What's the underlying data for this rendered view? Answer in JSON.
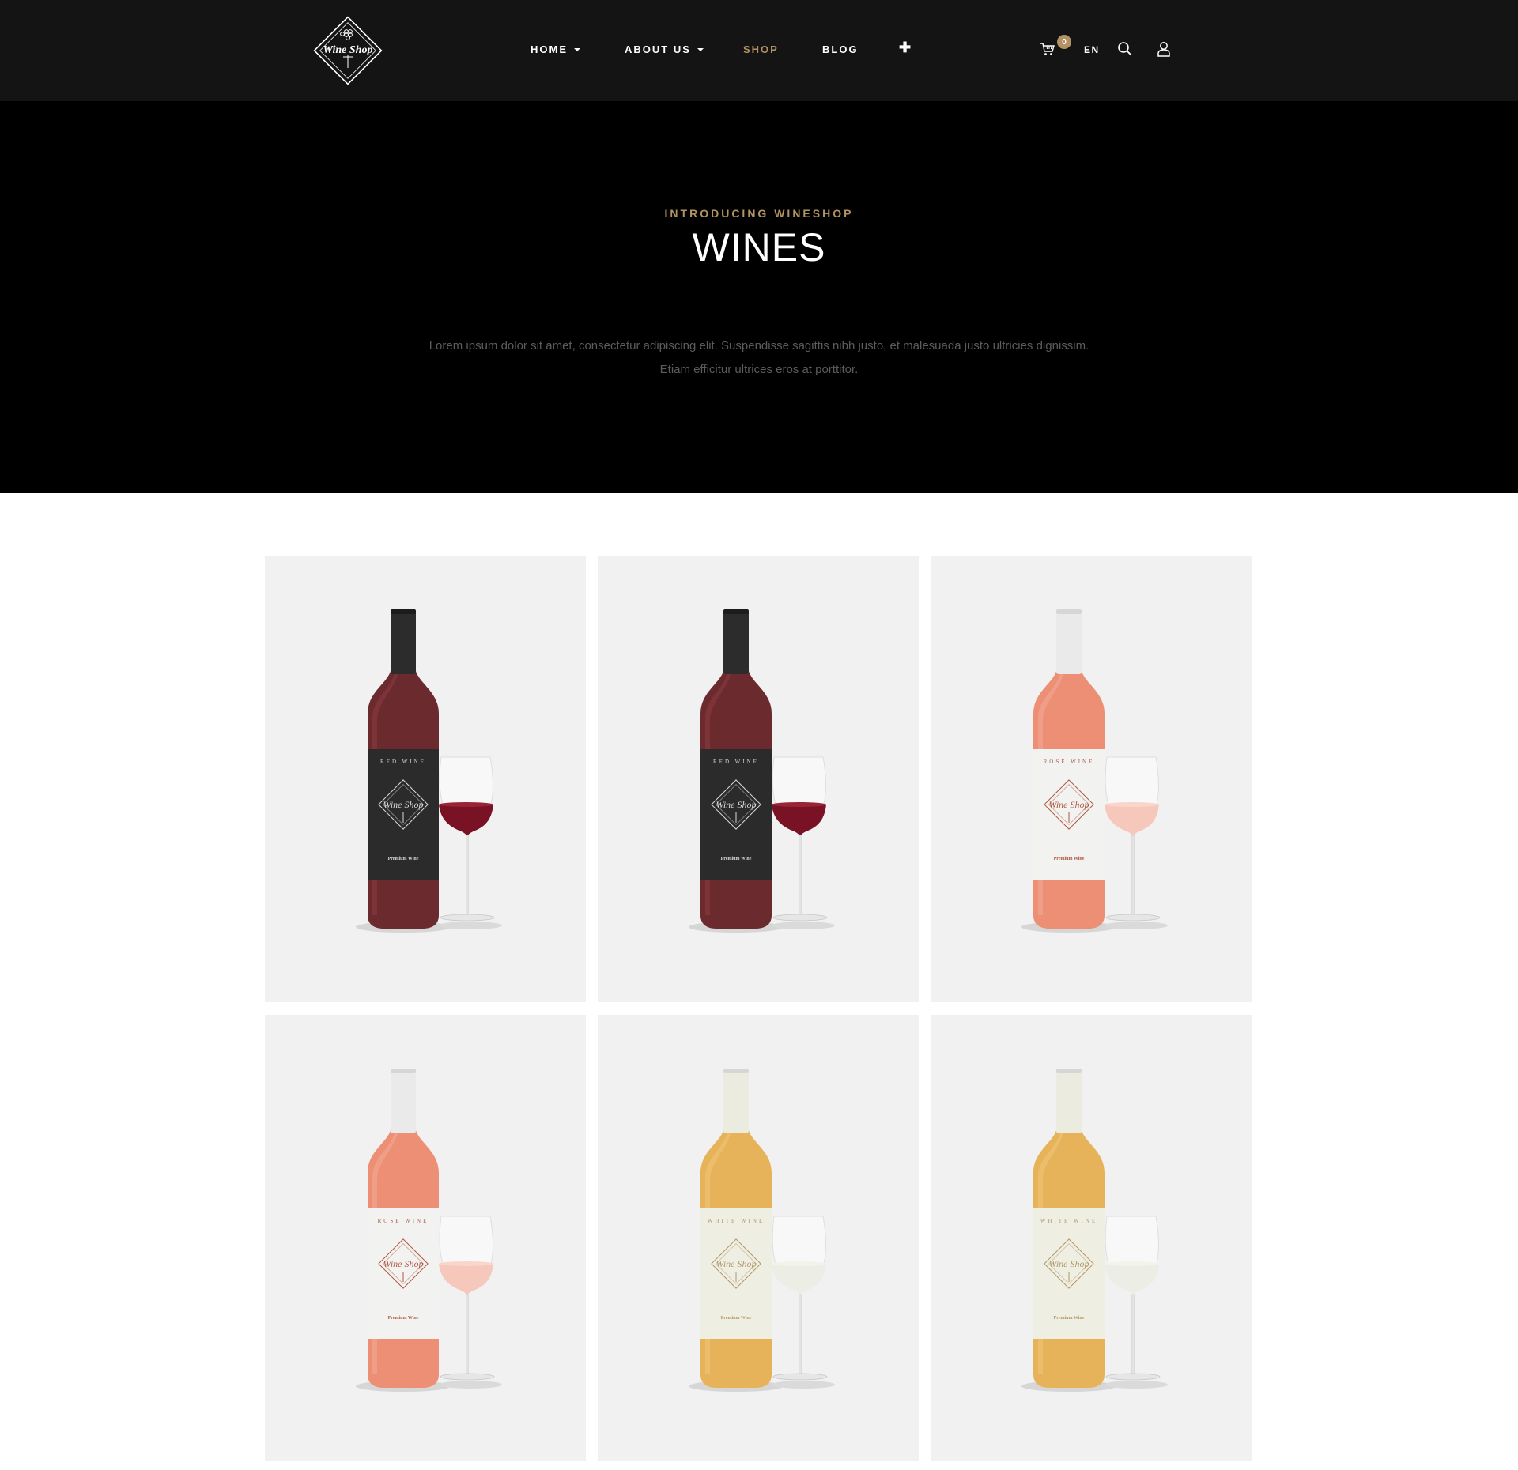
{
  "brand": {
    "logo_text": "Wine Shop"
  },
  "nav": {
    "items": [
      {
        "label": "HOME",
        "dropdown": true,
        "active": false
      },
      {
        "label": "ABOUT US",
        "dropdown": true,
        "active": false
      },
      {
        "label": "SHOP",
        "dropdown": false,
        "active": true
      },
      {
        "label": "BLOG",
        "dropdown": false,
        "active": false
      }
    ],
    "plus_icon": "plus-icon"
  },
  "tools": {
    "cart_count": "0",
    "language": "EN",
    "icons": [
      "cart-icon",
      "search-icon",
      "user-icon"
    ]
  },
  "hero": {
    "eyebrow": "INTRODUCING WINESHOP",
    "title": "WINES",
    "description": "Lorem ipsum dolor sit amet, consectetur adipiscing elit. Suspendisse sagittis nibh justo, et malesuada justo ultricies dignissim. Etiam efficitur ultrices eros at porttitor."
  },
  "products": [
    {
      "type": "RED WINE",
      "sub": "Premium Wine",
      "style": "red"
    },
    {
      "type": "RED WINE",
      "sub": "Premium Wine",
      "style": "red"
    },
    {
      "type": "ROSE WINE",
      "sub": "Premium Wine",
      "style": "rose"
    },
    {
      "type": "ROSE WINE",
      "sub": "Premium Wine",
      "style": "rose"
    },
    {
      "type": "WHITE WINE",
      "sub": "Premium Wine",
      "style": "white"
    },
    {
      "type": "WHITE WINE",
      "sub": "Premium Wine",
      "style": "white"
    }
  ],
  "colors": {
    "accent": "#b39363",
    "header_bg": "#141414",
    "hero_bg": "#000000",
    "card_bg": "#f1f1f1"
  }
}
